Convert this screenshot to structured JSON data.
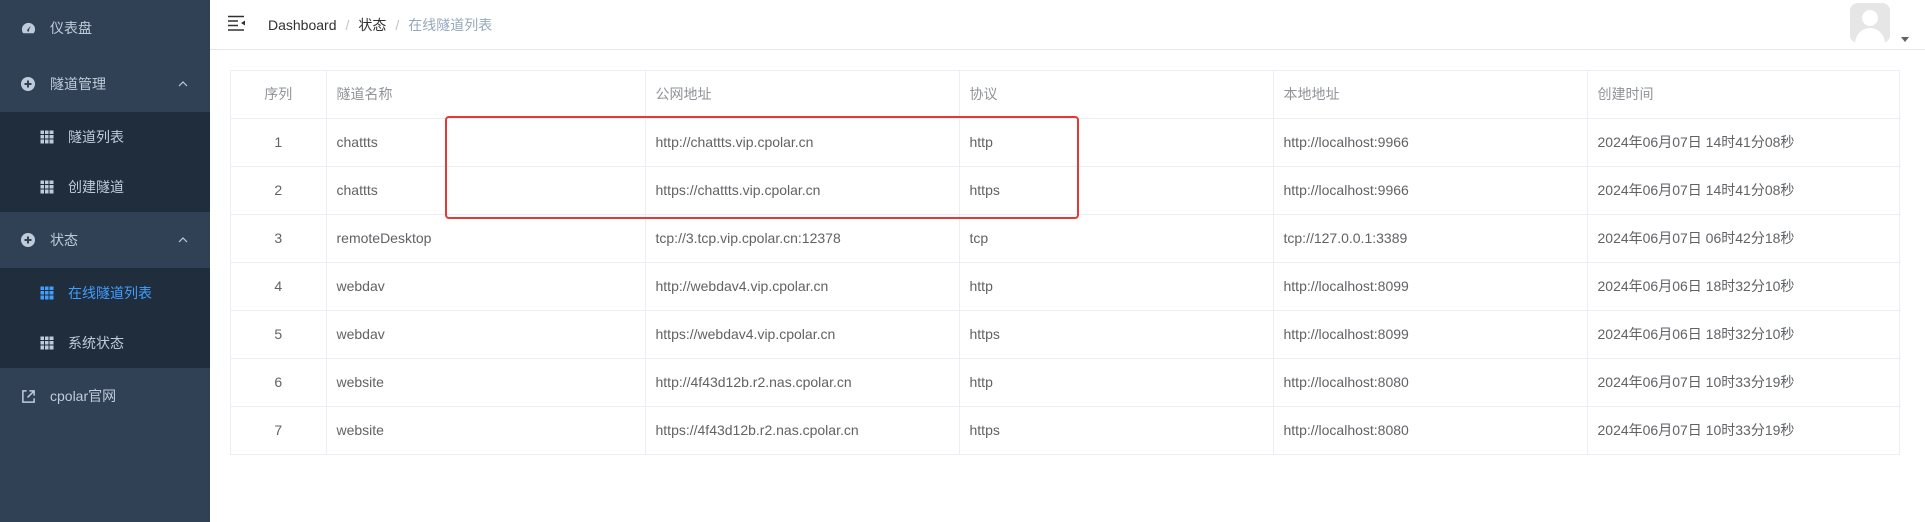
{
  "sidebar": {
    "items": [
      {
        "label": "仪表盘",
        "icon": "dashboard-icon"
      },
      {
        "label": "隧道管理",
        "icon": "plus-circle-icon",
        "children": [
          {
            "label": "隧道列表",
            "icon": "table-icon"
          },
          {
            "label": "创建隧道",
            "icon": "table-icon"
          }
        ]
      },
      {
        "label": "状态",
        "icon": "plus-circle-icon",
        "children": [
          {
            "label": "在线隧道列表",
            "icon": "table-icon",
            "active": true
          },
          {
            "label": "系统状态",
            "icon": "table-icon"
          }
        ]
      },
      {
        "label": "cpolar官网",
        "icon": "external-link-icon"
      }
    ]
  },
  "navbar": {
    "breadcrumb": [
      "Dashboard",
      "状态",
      "在线隧道列表"
    ]
  },
  "table": {
    "headers": [
      "序列",
      "隧道名称",
      "公网地址",
      "协议",
      "本地地址",
      "创建时间"
    ],
    "rows": [
      [
        "1",
        "chattts",
        "http://chattts.vip.cpolar.cn",
        "http",
        "http://localhost:9966",
        "2024年06月07日 14时41分08秒"
      ],
      [
        "2",
        "chattts",
        "https://chattts.vip.cpolar.cn",
        "https",
        "http://localhost:9966",
        "2024年06月07日 14时41分08秒"
      ],
      [
        "3",
        "remoteDesktop",
        "tcp://3.tcp.vip.cpolar.cn:12378",
        "tcp",
        "tcp://127.0.0.1:3389",
        "2024年06月07日 06时42分18秒"
      ],
      [
        "4",
        "webdav",
        "http://webdav4.vip.cpolar.cn",
        "http",
        "http://localhost:8099",
        "2024年06月06日 18时32分10秒"
      ],
      [
        "5",
        "webdav",
        "https://webdav4.vip.cpolar.cn",
        "https",
        "http://localhost:8099",
        "2024年06月06日 18时32分10秒"
      ],
      [
        "6",
        "website",
        "http://4f43d12b.r2.nas.cpolar.cn",
        "http",
        "http://localhost:8080",
        "2024年06月07日 10时33分19秒"
      ],
      [
        "7",
        "website",
        "https://4f43d12b.r2.nas.cpolar.cn",
        "https",
        "http://localhost:8080",
        "2024年06月07日 10时33分19秒"
      ]
    ]
  },
  "colors": {
    "sidebar_bg": "#304156",
    "submenu_bg": "#1f2d3d",
    "active": "#409eff",
    "highlight": "#e53935"
  }
}
